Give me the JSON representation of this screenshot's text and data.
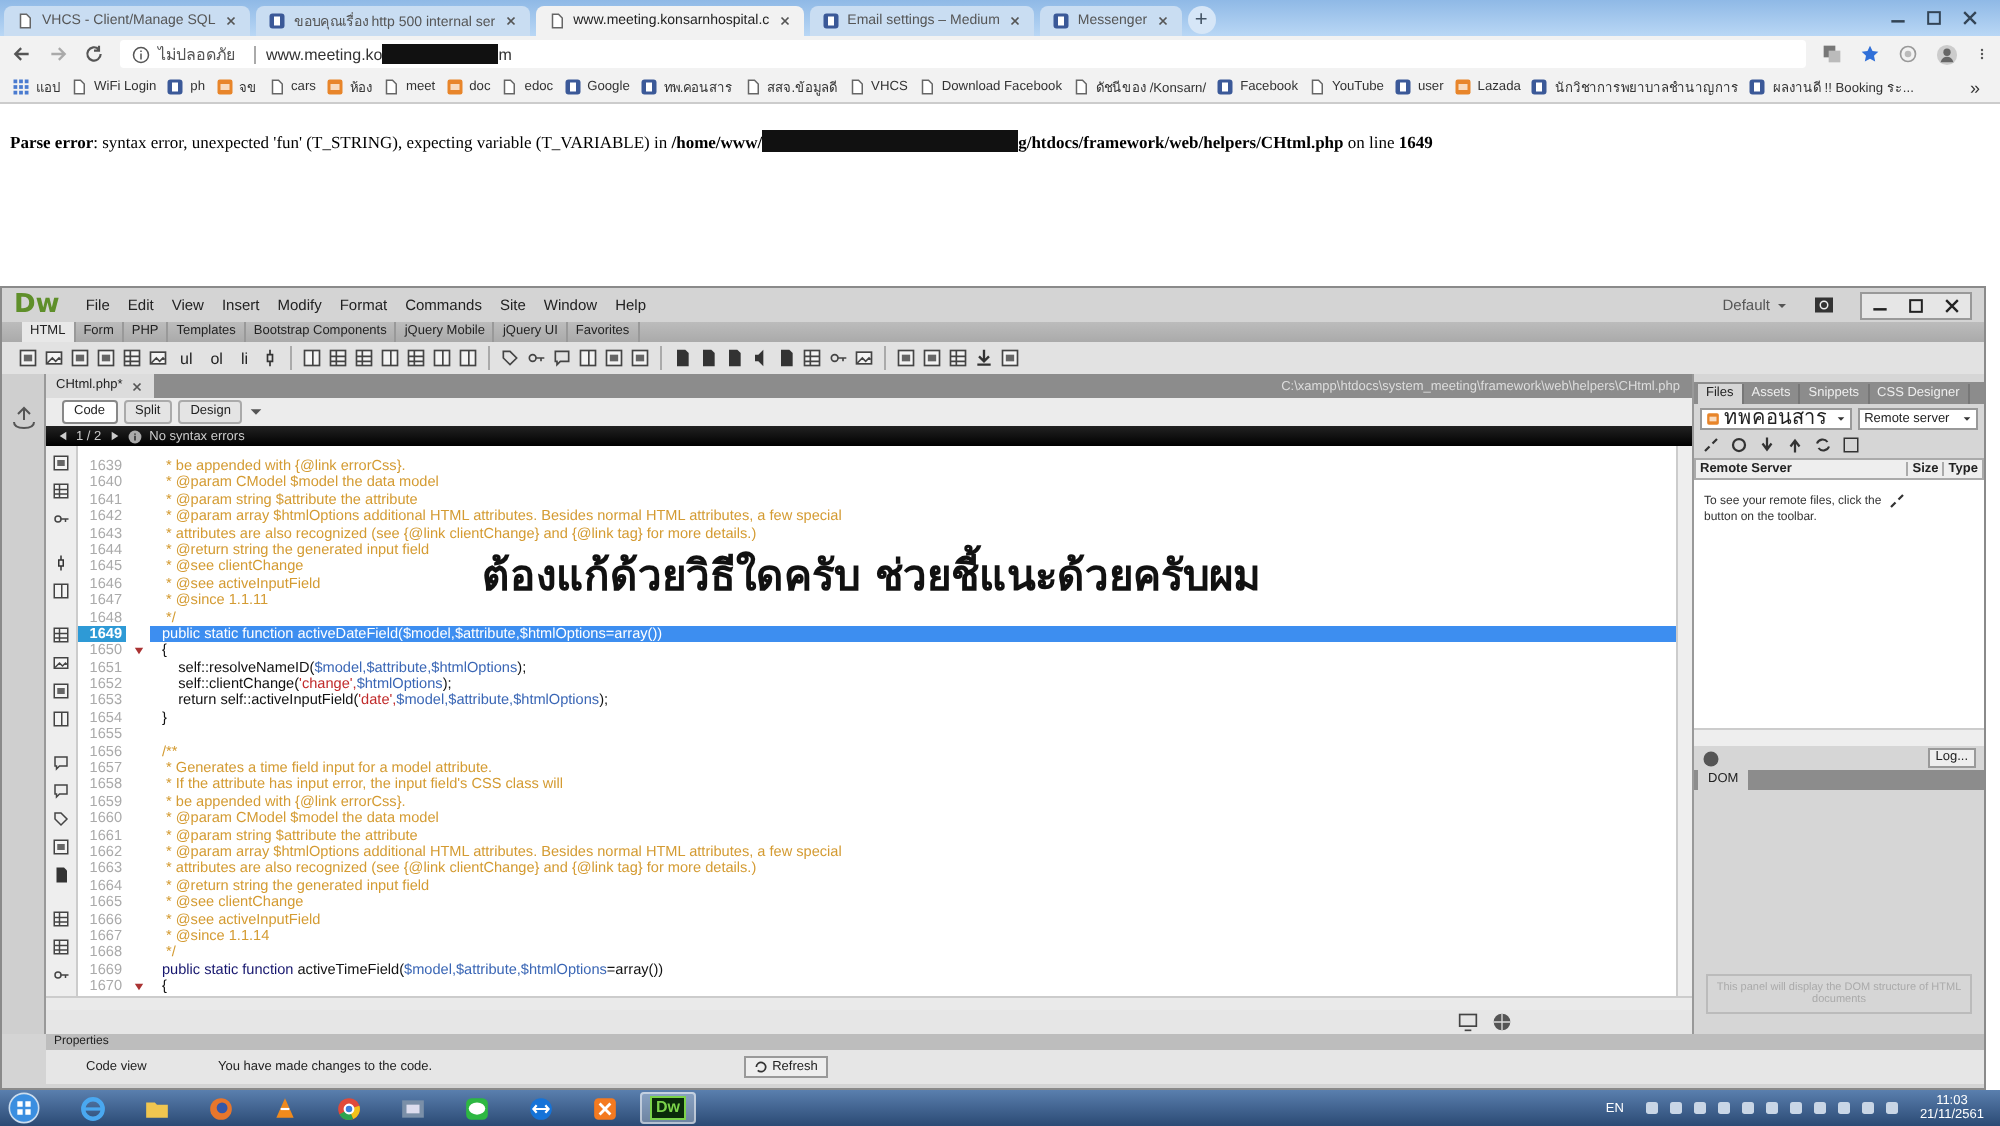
{
  "browser": {
    "tabs": [
      {
        "kind": "page",
        "title": "VHCS - Client/Manage SQL",
        "selected": false
      },
      {
        "kind": "site",
        "title": "ขอบคุณเรื่อง http 500 internal ser",
        "selected": false
      },
      {
        "kind": "page",
        "title": "www.meeting.konsarnhospital.c",
        "selected": true
      },
      {
        "kind": "site",
        "title": "Email settings – Medium",
        "selected": false
      },
      {
        "kind": "site",
        "title": "Messenger",
        "selected": false
      }
    ],
    "new_tab": "+",
    "security_label": "ไม่ปลอดภัย",
    "address": {
      "start": "www.meeting.ko",
      "end": "m"
    },
    "bookmarks": [
      {
        "kind": "apps",
        "label": "แอป"
      },
      {
        "kind": "page",
        "label": "WiFi Login"
      },
      {
        "kind": "site",
        "label": "ph"
      },
      {
        "kind": "folder",
        "label": "จข"
      },
      {
        "kind": "page",
        "label": "cars"
      },
      {
        "kind": "folder",
        "label": "ห้อง"
      },
      {
        "kind": "page",
        "label": "meet"
      },
      {
        "kind": "folder",
        "label": "doc"
      },
      {
        "kind": "page",
        "label": "edoc"
      },
      {
        "kind": "site",
        "label": "Google"
      },
      {
        "kind": "site",
        "label": "ทพ.คอนสาร"
      },
      {
        "kind": "page",
        "label": "สสจ.ข้อมูลดี"
      },
      {
        "kind": "page",
        "label": "VHCS"
      },
      {
        "kind": "page",
        "label": "Download Facebook"
      },
      {
        "kind": "page",
        "label": "ดัชนีของ /Konsarn/"
      },
      {
        "kind": "site",
        "label": "Facebook"
      },
      {
        "kind": "page",
        "label": "YouTube"
      },
      {
        "kind": "site",
        "label": "user"
      },
      {
        "kind": "folder",
        "label": "Lazada"
      },
      {
        "kind": "site",
        "label": "นักวิชาการพยาบาลชำนาญการ"
      },
      {
        "kind": "site",
        "label": "ผลงานดี !! Booking ระ..."
      }
    ],
    "bookmarks_more": "»"
  },
  "page": {
    "error_start": "**Parse error**: syntax error, unexpected 'fun' (T_STRING), expecting variable (T_VARIABLE) in **/home/www/**",
    "error_end": "**g/htdocs/framework/web/helpers/CHtml.php** on line **1649**"
  },
  "dreamweaver": {
    "logo": "Dw",
    "menu": [
      "File",
      "Edit",
      "View",
      "Insert",
      "Modify",
      "Format",
      "Commands",
      "Site",
      "Window",
      "Help"
    ],
    "workspace": "Default",
    "insert_tabs": [
      {
        "label": "HTML",
        "selected": true
      },
      {
        "label": "Form",
        "selected": false
      },
      {
        "label": "PHP",
        "selected": false
      },
      {
        "label": "Templates",
        "selected": false
      },
      {
        "label": "Bootstrap Components",
        "selected": false
      },
      {
        "label": "jQuery Mobile",
        "selected": false
      },
      {
        "label": "jQuery UI",
        "selected": false
      },
      {
        "label": "Favorites",
        "selected": false
      }
    ],
    "toolbar_labels": [
      "ul",
      "ol",
      "li"
    ],
    "document": {
      "tab": "CHtml.php*",
      "path": "C:\\xampp\\htdocs\\system_meeting\\framework\\web\\helpers\\CHtml.php",
      "views": [
        {
          "label": "Code",
          "selected": true
        },
        {
          "label": "Split",
          "selected": false
        },
        {
          "label": "Design",
          "selected": false
        }
      ],
      "pager": "1 / 2",
      "syntax_status": "No syntax errors"
    },
    "code": {
      "lines": [
        {
          "number": "1639",
          "kind": "comment",
          "text": " * be appended with {@link errorCss}.",
          "fold": false,
          "selected": false
        },
        {
          "number": "1640",
          "kind": "comment",
          "text": " * @param CModel $model the data model",
          "fold": false,
          "selected": false
        },
        {
          "number": "1641",
          "kind": "comment",
          "text": " * @param string $attribute the attribute",
          "fold": false,
          "selected": false
        },
        {
          "number": "1642",
          "kind": "comment",
          "text": " * @param array $htmlOptions additional HTML attributes. Besides normal HTML attributes, a few special",
          "fold": false,
          "selected": false
        },
        {
          "number": "1643",
          "kind": "comment",
          "text": " * attributes are also recognized (see {@link clientChange} and {@link tag} for more details.)",
          "fold": false,
          "selected": false
        },
        {
          "number": "1644",
          "kind": "comment",
          "text": " * @return string the generated input field",
          "fold": false,
          "selected": false
        },
        {
          "number": "1645",
          "kind": "comment",
          "text": " * @see clientChange",
          "fold": false,
          "selected": false
        },
        {
          "number": "1646",
          "kind": "comment",
          "text": " * @see activeInputField",
          "fold": false,
          "selected": false
        },
        {
          "number": "1647",
          "kind": "comment",
          "text": " * @since 1.1.11",
          "fold": false,
          "selected": false
        },
        {
          "number": "1648",
          "kind": "comment",
          "text": " */",
          "fold": false,
          "selected": false
        },
        {
          "number": "1649",
          "kind": "code",
          "segments": [
            {
              "kind": "keyword",
              "text": "public static function "
            },
            {
              "kind": "name",
              "text": "activeDateField("
            },
            {
              "kind": "variable",
              "text": "$model,$attribute,$htmlOptions"
            },
            {
              "kind": "name",
              "text": "=array())"
            }
          ],
          "fold": false,
          "selected": true
        },
        {
          "number": "1650",
          "kind": "code",
          "segments": [
            {
              "kind": "name",
              "text": "{"
            }
          ],
          "fold": true,
          "selected": false
        },
        {
          "number": "1651",
          "kind": "code",
          "segments": [
            {
              "kind": "name",
              "text": "    self::resolveNameID("
            },
            {
              "kind": "variable",
              "text": "$model,$attribute,$htmlOptions"
            },
            {
              "kind": "name",
              "text": ");"
            }
          ],
          "fold": false,
          "selected": false
        },
        {
          "number": "1652",
          "kind": "code",
          "segments": [
            {
              "kind": "name",
              "text": "    self::clientChange("
            },
            {
              "kind": "string",
              "text": "'change',"
            },
            {
              "kind": "variable",
              "text": "$htmlOptions"
            },
            {
              "kind": "name",
              "text": ");"
            }
          ],
          "fold": false,
          "selected": false
        },
        {
          "number": "1653",
          "kind": "code",
          "segments": [
            {
              "kind": "name",
              "text": "    return self::activeInputField("
            },
            {
              "kind": "string",
              "text": "'date',"
            },
            {
              "kind": "variable",
              "text": "$model,$attribute,$htmlOptions"
            },
            {
              "kind": "name",
              "text": ");"
            }
          ],
          "fold": false,
          "selected": false
        },
        {
          "number": "1654",
          "kind": "code",
          "segments": [
            {
              "kind": "name",
              "text": "}"
            }
          ],
          "fold": false,
          "selected": false
        },
        {
          "number": "1655",
          "kind": "blank",
          "fold": false,
          "selected": false
        },
        {
          "number": "1656",
          "kind": "comment",
          "text": "/**",
          "fold": false,
          "selected": false
        },
        {
          "number": "1657",
          "kind": "comment",
          "text": " * Generates a time field input for a model attribute.",
          "fold": false,
          "selected": false
        },
        {
          "number": "1658",
          "kind": "comment",
          "text": " * If the attribute has input error, the input field's CSS class will",
          "fold": false,
          "selected": false
        },
        {
          "number": "1659",
          "kind": "comment",
          "text": " * be appended with {@link errorCss}.",
          "fold": false,
          "selected": false
        },
        {
          "number": "1660",
          "kind": "comment",
          "text": " * @param CModel $model the data model",
          "fold": false,
          "selected": false
        },
        {
          "number": "1661",
          "kind": "comment",
          "text": " * @param string $attribute the attribute",
          "fold": false,
          "selected": false
        },
        {
          "number": "1662",
          "kind": "comment",
          "text": " * @param array $htmlOptions additional HTML attributes. Besides normal HTML attributes, a few special",
          "fold": false,
          "selected": false
        },
        {
          "number": "1663",
          "kind": "comment",
          "text": " * attributes are also recognized (see {@link clientChange} and {@link tag} for more details.)",
          "fold": false,
          "selected": false
        },
        {
          "number": "1664",
          "kind": "comment",
          "text": " * @return string the generated input field",
          "fold": false,
          "selected": false
        },
        {
          "number": "1665",
          "kind": "comment",
          "text": " * @see clientChange",
          "fold": false,
          "selected": false
        },
        {
          "number": "1666",
          "kind": "comment",
          "text": " * @see activeInputField",
          "fold": false,
          "selected": false
        },
        {
          "number": "1667",
          "kind": "comment",
          "text": " * @since 1.1.14",
          "fold": false,
          "selected": false
        },
        {
          "number": "1668",
          "kind": "comment",
          "text": " */",
          "fold": false,
          "selected": false
        },
        {
          "number": "1669",
          "kind": "code",
          "segments": [
            {
              "kind": "keyword",
              "text": "public static function "
            },
            {
              "kind": "name",
              "text": "activeTimeField("
            },
            {
              "kind": "variable",
              "text": "$model,$attribute,$htmlOptions"
            },
            {
              "kind": "name",
              "text": "=array())"
            }
          ],
          "fold": false,
          "selected": false
        },
        {
          "number": "1670",
          "kind": "code",
          "segments": [
            {
              "kind": "name",
              "text": "{"
            }
          ],
          "fold": true,
          "selected": false
        }
      ]
    },
    "overlay_note": "ต้องแก้ด้วยวิธีใดครับ ช่วยชี้แนะด้วยครับผม",
    "files_panel": {
      "tabs": [
        {
          "label": "Files",
          "selected": true
        },
        {
          "label": "Assets",
          "selected": false
        },
        {
          "label": "Snippets",
          "selected": false
        },
        {
          "label": "CSS Designer",
          "selected": false
        }
      ],
      "site": "ทพคอนสาร",
      "server": "Remote server",
      "columns": [
        "Remote Server",
        "Size",
        "Type"
      ],
      "message_start": "To see your remote files, click the",
      "message_end": "button on the toolbar.",
      "log_button": "Log..."
    },
    "dom_panel": {
      "tab": "DOM",
      "message": "This panel will display the DOM structure of HTML documents"
    },
    "properties": {
      "title": "Properties",
      "mode": "Code view",
      "message": "You have made changes to the code.",
      "refresh_button": "Refresh"
    }
  },
  "taskbar": {
    "apps": [
      {
        "kind": "ie",
        "active": false
      },
      {
        "kind": "explorer",
        "active": false
      },
      {
        "kind": "firefox",
        "active": false
      },
      {
        "kind": "vlc",
        "active": false
      },
      {
        "kind": "chrome",
        "active": false
      },
      {
        "kind": "app",
        "active": false
      },
      {
        "kind": "line",
        "active": false
      },
      {
        "kind": "teamviewer",
        "active": false
      },
      {
        "kind": "xampp",
        "active": false
      },
      {
        "kind": "dw",
        "label": "Dw",
        "active": true
      }
    ],
    "language": "EN",
    "time": "11:03",
    "date": "21/11/2561"
  }
}
